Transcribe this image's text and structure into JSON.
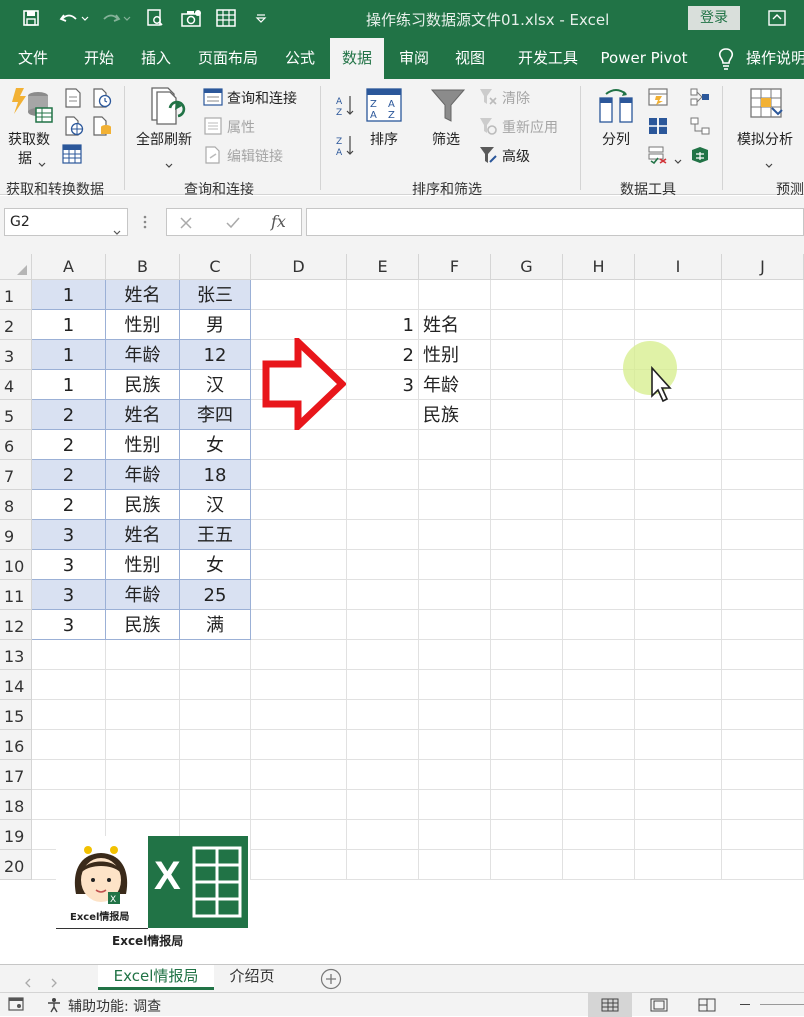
{
  "titlebar": {
    "title": "操作练习数据源文件01.xlsx  -  Excel",
    "login": "登录"
  },
  "menu": [
    "文件",
    "开始",
    "插入",
    "页面布局",
    "公式",
    "数据",
    "审阅",
    "视图",
    "开发工具",
    "Power Pivot",
    "操作说明"
  ],
  "ribbon": {
    "get_data": "获取数",
    "get_data2": "据",
    "refresh_all": "全部刷新",
    "query_connect": "查询和连接",
    "properties": "属性",
    "edit_links": "编辑链接",
    "sort": "排序",
    "filter": "筛选",
    "clear": "清除",
    "reapply": "重新应用",
    "advanced": "高级",
    "split": "分列",
    "whatif": "模拟分析",
    "groups": {
      "get_transform": "获取和转换数据",
      "queries": "查询和连接",
      "sort_filter": "排序和筛选",
      "data_tools": "数据工具",
      "forecast": "预测"
    }
  },
  "formula_bar": {
    "name_box": "G2",
    "fx": "fx",
    "value": ""
  },
  "columns": [
    "A",
    "B",
    "C",
    "D",
    "E",
    "F",
    "G",
    "H",
    "I",
    "J"
  ],
  "rows": [
    "1",
    "2",
    "3",
    "4",
    "5",
    "6",
    "7",
    "8",
    "9",
    "10",
    "11",
    "12",
    "13",
    "14",
    "15",
    "16",
    "17",
    "18",
    "19",
    "20"
  ],
  "table": [
    [
      "1",
      "姓名",
      "张三"
    ],
    [
      "1",
      "性别",
      "男"
    ],
    [
      "1",
      "年龄",
      "12"
    ],
    [
      "1",
      "民族",
      "汉"
    ],
    [
      "2",
      "姓名",
      "李四"
    ],
    [
      "2",
      "性别",
      "女"
    ],
    [
      "2",
      "年龄",
      "18"
    ],
    [
      "2",
      "民族",
      "汉"
    ],
    [
      "3",
      "姓名",
      "王五"
    ],
    [
      "3",
      "性别",
      "女"
    ],
    [
      "3",
      "年龄",
      "25"
    ],
    [
      "3",
      "民族",
      "满"
    ]
  ],
  "result": {
    "numbers": [
      "1",
      "2",
      "3"
    ],
    "fields": [
      "姓名",
      "性别",
      "年龄",
      "民族"
    ]
  },
  "logo": {
    "caption_small": "Excel情报局",
    "caption": "Excel情报局",
    "excel_letter": "X"
  },
  "sheets": {
    "active": "Excel情报局",
    "other": "介绍页"
  },
  "status": {
    "accessibility": "辅助功能: 调查"
  },
  "colors": {
    "excel_green": "#217346",
    "band_blue": "#d9e1f2",
    "arrow_red": "#e8161b"
  }
}
